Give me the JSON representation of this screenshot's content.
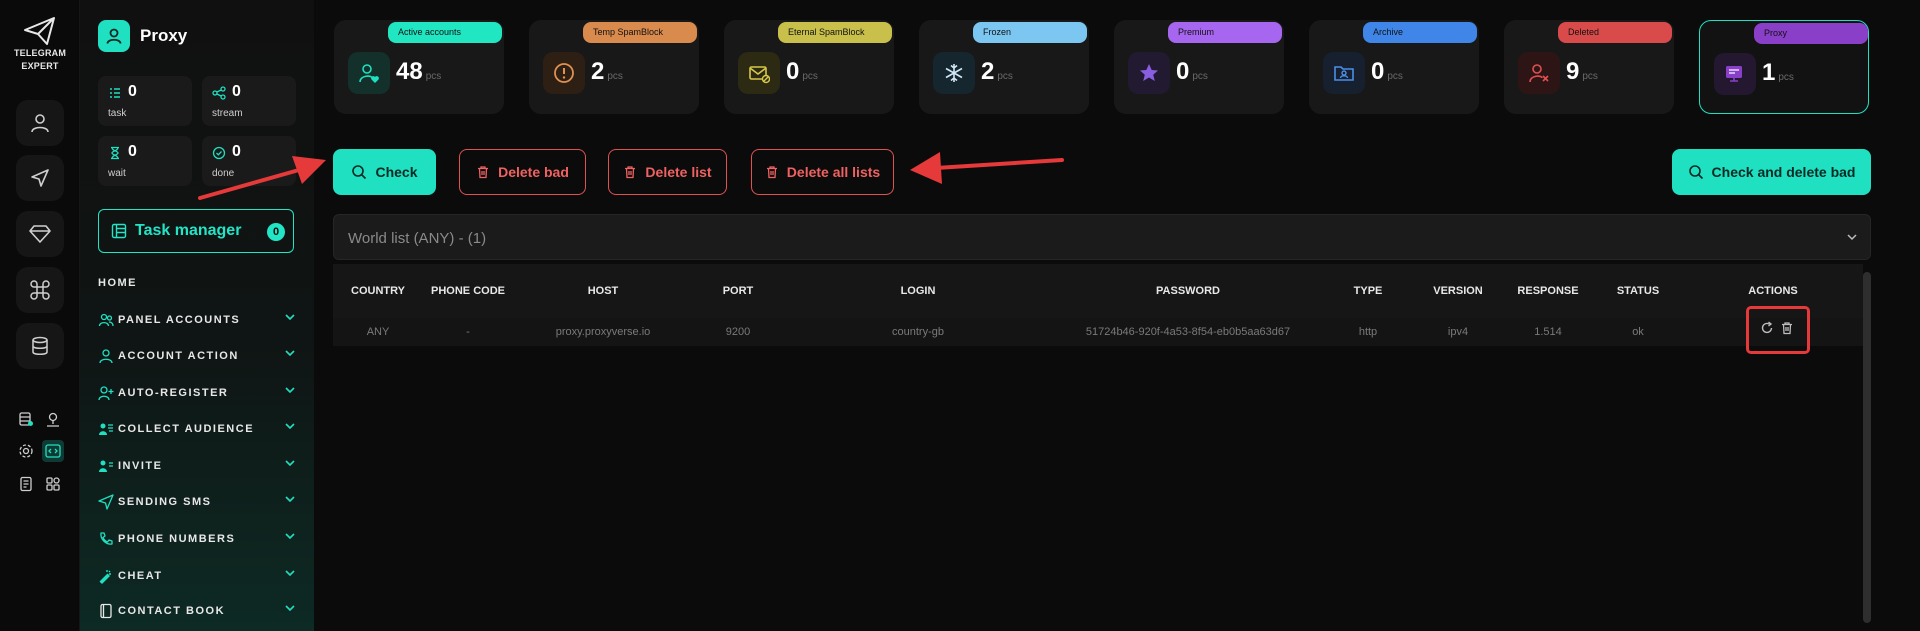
{
  "brand": {
    "line1": "TELEGRAM",
    "line2": "EXPERT"
  },
  "panel": {
    "title": "Proxy",
    "stats": [
      {
        "value": "0",
        "label": "task"
      },
      {
        "value": "0",
        "label": "stream"
      },
      {
        "value": "0",
        "label": "wait"
      },
      {
        "value": "0",
        "label": "done"
      }
    ],
    "task_manager": {
      "label": "Task manager",
      "count": "0"
    },
    "home": "HOME",
    "nav": [
      {
        "label": "PANEL ACCOUNTS",
        "icon": "users-icon"
      },
      {
        "label": "ACCOUNT ACTION",
        "icon": "user-icon"
      },
      {
        "label": "AUTO-REGISTER",
        "icon": "user-plus-icon"
      },
      {
        "label": "COLLECT AUDIENCE",
        "icon": "audience-icon"
      },
      {
        "label": "INVITE",
        "icon": "invite-icon"
      },
      {
        "label": "SENDING SMS",
        "icon": "send-icon"
      },
      {
        "label": "PHONE NUMBERS",
        "icon": "phone-icon"
      },
      {
        "label": "CHEAT",
        "icon": "magic-icon"
      },
      {
        "label": "CONTACT BOOK",
        "icon": "book-icon"
      }
    ]
  },
  "cards": [
    {
      "label": "Active accounts",
      "value": "48",
      "unit": "pcs",
      "color": "#20e6c2"
    },
    {
      "label": "Temp SpamBlock",
      "value": "2",
      "unit": "pcs",
      "color": "#d98a4d"
    },
    {
      "label": "Eternal SpamBlock",
      "value": "0",
      "unit": "pcs",
      "color": "#c8c04a"
    },
    {
      "label": "Frozen",
      "value": "2",
      "unit": "pcs",
      "color": "#7cc6f2"
    },
    {
      "label": "Premium",
      "value": "0",
      "unit": "pcs",
      "color": "#a766f0"
    },
    {
      "label": "Archive",
      "value": "0",
      "unit": "pcs",
      "color": "#3f86e8"
    },
    {
      "label": "Deleted",
      "value": "9",
      "unit": "pcs",
      "color": "#d94b4b"
    },
    {
      "label": "Proxy",
      "value": "1",
      "unit": "pcs",
      "color": "#8a3fc8"
    }
  ],
  "toolbar": {
    "check": "Check",
    "delete_bad": "Delete bad",
    "delete_list": "Delete list",
    "delete_all_lists": "Delete all lists",
    "check_and_delete_bad": "Check and delete bad"
  },
  "list_select": {
    "value": "World list (ANY) - (1)"
  },
  "table": {
    "columns": [
      "COUNTRY",
      "PHONE CODE",
      "HOST",
      "PORT",
      "LOGIN",
      "PASSWORD",
      "TYPE",
      "VERSION",
      "RESPONSE",
      "STATUS",
      "ACTIONS"
    ],
    "rows": [
      [
        "ANY",
        "-",
        "proxy.proxyverse.io",
        "9200",
        "country-gb",
        "51724b46-920f-4a53-8f54-eb0b5aa63d67",
        "http",
        "ipv4",
        "1.514",
        "ok"
      ]
    ]
  },
  "colors": {
    "accent": "#1fe0c0",
    "danger": "#e05252",
    "highlight": "#e5393a"
  }
}
